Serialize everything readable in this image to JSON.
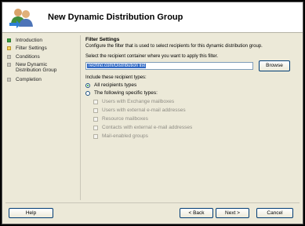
{
  "window": {
    "title": "New Dynamic Distribution Group"
  },
  "sidebar": {
    "items": [
      {
        "label": "Introduction",
        "state": "done"
      },
      {
        "label": "Filter Settings",
        "state": "current"
      },
      {
        "label": "Conditions",
        "state": "todo"
      },
      {
        "label": "New Dynamic Distribution Group",
        "state": "todo"
      },
      {
        "label": "Completion",
        "state": "todo"
      }
    ]
  },
  "main": {
    "section_title": "Filter Settings",
    "description": "Configure the filter that is used to select recipients for this dynamic distribution group.",
    "container_label": "Select the recipient container where you want to apply this filter.",
    "container_value": "Techno.com/Distribution list",
    "browse_label": "Browse",
    "include_label": "Include these recipient types:",
    "radio_all": "All recipients types",
    "radio_specific": "The following specific types:",
    "checkboxes": [
      "Users with Exchange mailboxes",
      "Users with external e-mail addresses",
      "Resource mailboxes",
      "Contacts with external e-mail addresses",
      "Mail-enabled groups"
    ]
  },
  "footer": {
    "help": "Help",
    "back": "< Back",
    "next": "Next >",
    "cancel": "Cancel"
  },
  "colors": {
    "step_done": "#3aa040",
    "step_current": "#f5d35a",
    "step_todo": "#c8c6bc",
    "selection": "#316ac5"
  }
}
